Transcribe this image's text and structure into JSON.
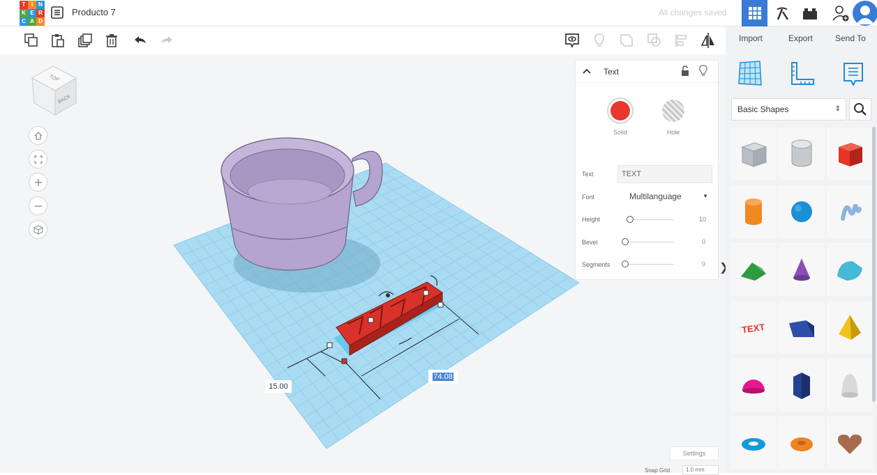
{
  "logo": {
    "letters": [
      "T",
      "I",
      "N",
      "K",
      "E",
      "R",
      "C",
      "A",
      "D"
    ]
  },
  "header": {
    "title": "Producto 7",
    "save_status": "All changes saved"
  },
  "toolbar": {
    "import_label": "Import",
    "export_label": "Export",
    "send_label": "Send To"
  },
  "inspector": {
    "title": "Text",
    "solid_label": "Solid",
    "hole_label": "Hole",
    "solid_color": "#e8372e",
    "text_label": "Text",
    "text_value": "TEXT",
    "font_label": "Font",
    "font_value": "Multilanguage",
    "height_label": "Height",
    "height_value": "10",
    "bevel_label": "Bevel",
    "bevel_value": "0",
    "segments_label": "Segments",
    "segments_value": "0"
  },
  "workplane": {
    "width_value": "15.00",
    "length_value": "74.08",
    "settings_label": "Settings",
    "snap_label": "Snap Grid",
    "snap_value": "1.0 mm",
    "cube_top": "TOP",
    "cube_back": "BACK",
    "grid_color": "#a9dbf3"
  },
  "shapes_panel": {
    "category": "Basic Shapes",
    "shapes": [
      {
        "name": "box-hole",
        "color": "#b9bec6"
      },
      {
        "name": "cylinder-hole",
        "color": "#c6cace"
      },
      {
        "name": "box",
        "color": "#e53527"
      },
      {
        "name": "cylinder",
        "color": "#f08a20"
      },
      {
        "name": "sphere",
        "color": "#1b8fd6"
      },
      {
        "name": "scribble",
        "color": "#8ab4e0"
      },
      {
        "name": "roof",
        "color": "#2e9b3e"
      },
      {
        "name": "cone",
        "color": "#8a4fb5"
      },
      {
        "name": "round-roof",
        "color": "#46b9d6"
      },
      {
        "name": "text",
        "color": "#e53527"
      },
      {
        "name": "wedge",
        "color": "#2d4fa8"
      },
      {
        "name": "pyramid",
        "color": "#f3c21a"
      },
      {
        "name": "half-sphere",
        "color": "#e6178f"
      },
      {
        "name": "polygon",
        "color": "#25418f"
      },
      {
        "name": "paraboloid",
        "color": "#d9d9d9"
      },
      {
        "name": "torus",
        "color": "#159ad8"
      },
      {
        "name": "tube",
        "color": "#ee8422"
      },
      {
        "name": "heart",
        "color": "#a86a4e"
      }
    ]
  },
  "colors": {
    "accent": "#3a7bd5",
    "cup": "#b5a4cf"
  }
}
